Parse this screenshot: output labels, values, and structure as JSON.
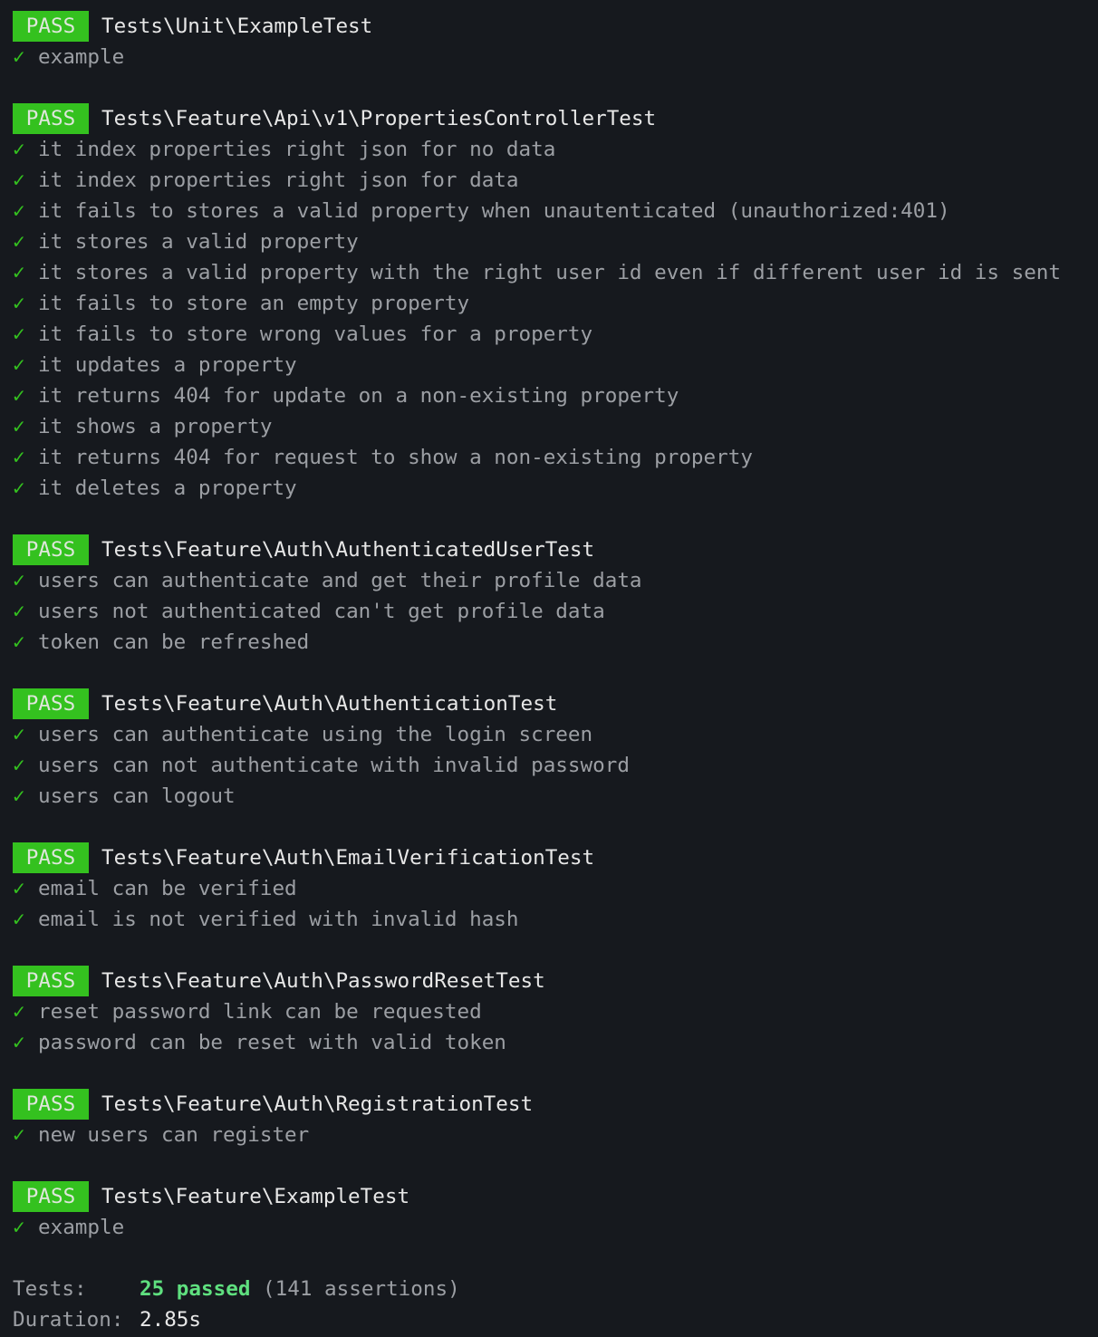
{
  "colors": {
    "background": "#16191e",
    "pass_badge": "#34c11f",
    "check": "#34c11f",
    "passed_text": "#5fe07f",
    "muted_text": "#9c9fa4"
  },
  "icons": {
    "check": "check-mark-icon"
  },
  "check_glyph": "✓",
  "suites": [
    {
      "status": "PASS",
      "name": "Tests\\Unit\\ExampleTest",
      "tests": [
        "example"
      ]
    },
    {
      "status": "PASS",
      "name": "Tests\\Feature\\Api\\v1\\PropertiesControllerTest",
      "tests": [
        "it index properties right json for no data",
        "it index properties right json for data",
        "it fails to stores a valid property when unautenticated (unauthorized:401)",
        "it stores a valid property",
        "it stores a valid property with the right user id even if different user id is sent",
        "it fails to store an empty property",
        "it fails to store wrong values for a property",
        "it updates a property",
        "it returns 404 for update on a non-existing property",
        "it shows a property",
        "it returns 404 for request to show a non-existing property",
        "it deletes a property"
      ]
    },
    {
      "status": "PASS",
      "name": "Tests\\Feature\\Auth\\AuthenticatedUserTest",
      "tests": [
        "users can authenticate and get their profile data",
        "users not authenticated can't get profile data",
        "token can be refreshed"
      ]
    },
    {
      "status": "PASS",
      "name": "Tests\\Feature\\Auth\\AuthenticationTest",
      "tests": [
        "users can authenticate using the login screen",
        "users can not authenticate with invalid password",
        "users can logout"
      ]
    },
    {
      "status": "PASS",
      "name": "Tests\\Feature\\Auth\\EmailVerificationTest",
      "tests": [
        "email can be verified",
        "email is not verified with invalid hash"
      ]
    },
    {
      "status": "PASS",
      "name": "Tests\\Feature\\Auth\\PasswordResetTest",
      "tests": [
        "reset password link can be requested",
        "password can be reset with valid token"
      ]
    },
    {
      "status": "PASS",
      "name": "Tests\\Feature\\Auth\\RegistrationTest",
      "tests": [
        "new users can register"
      ]
    },
    {
      "status": "PASS",
      "name": "Tests\\Feature\\ExampleTest",
      "tests": [
        "example"
      ]
    }
  ],
  "summary": {
    "tests_label": "Tests:",
    "passed": "25 passed",
    "assertions": "(141 assertions)",
    "duration_label": "Duration:",
    "duration": "2.85s"
  }
}
